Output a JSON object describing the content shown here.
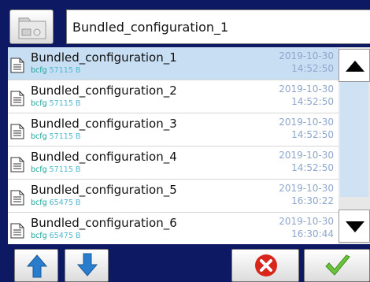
{
  "header": {
    "folder_icon": "folder-icon",
    "filename": "Bundled_configuration_1"
  },
  "files": [
    {
      "name": "Bundled_configuration_1",
      "ext": "bcfg",
      "size": "57115 B",
      "date": "2019-10-30",
      "time": "14:52:50",
      "selected": true
    },
    {
      "name": "Bundled_configuration_2",
      "ext": "bcfg",
      "size": "57115 B",
      "date": "2019-10-30",
      "time": "14:52:50",
      "selected": false
    },
    {
      "name": "Bundled_configuration_3",
      "ext": "bcfg",
      "size": "57115 B",
      "date": "2019-10-30",
      "time": "14:52:50",
      "selected": false
    },
    {
      "name": "Bundled_configuration_4",
      "ext": "bcfg",
      "size": "57115 B",
      "date": "2019-10-30",
      "time": "14:52:50",
      "selected": false
    },
    {
      "name": "Bundled_configuration_5",
      "ext": "bcfg",
      "size": "65475 B",
      "date": "2019-10-30",
      "time": "16:30:22",
      "selected": false
    },
    {
      "name": "Bundled_configuration_6",
      "ext": "bcfg",
      "size": "65475 B",
      "date": "2019-10-30",
      "time": "16:30:44",
      "selected": false
    }
  ],
  "scrollbar": {
    "up_icon": "triangle-up-icon",
    "down_icon": "triangle-down-icon"
  },
  "toolbar": {
    "up_icon": "arrow-up-icon",
    "down_icon": "arrow-down-icon",
    "cancel_icon": "cancel-icon",
    "confirm_icon": "checkmark-icon"
  },
  "colors": {
    "background": "#0d1a63",
    "selected_row": "#c7def3",
    "extension": "#1aa59a",
    "size": "#4fb8d0",
    "timestamp": "#8ea6cc",
    "arrow": "#2a7dcd",
    "cancel": "#d9261c",
    "confirm": "#6cc43a"
  }
}
